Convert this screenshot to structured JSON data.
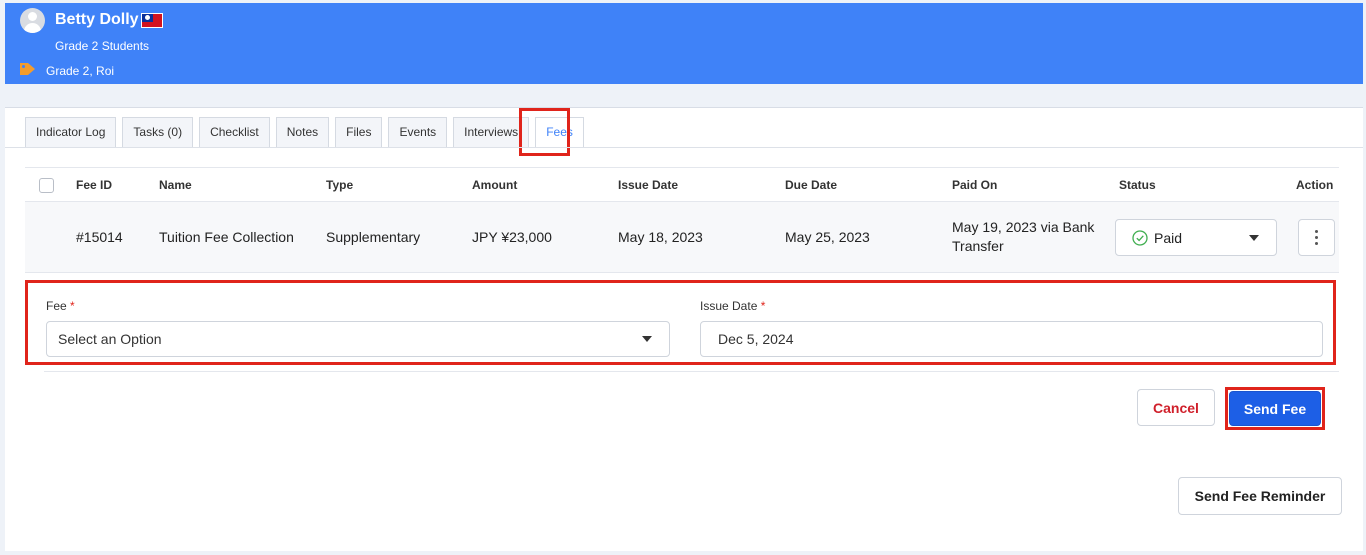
{
  "student": {
    "name": "Betty Dolly",
    "grade_line": "Grade 2 Students",
    "tags": "Grade 2, Roi"
  },
  "tabs": [
    {
      "label": "Indicator Log",
      "active": false
    },
    {
      "label": "Tasks (0)",
      "active": false
    },
    {
      "label": "Checklist",
      "active": false
    },
    {
      "label": "Notes",
      "active": false
    },
    {
      "label": "Files",
      "active": false
    },
    {
      "label": "Events",
      "active": false
    },
    {
      "label": "Interviews",
      "active": false
    },
    {
      "label": "Fees",
      "active": true
    }
  ],
  "table": {
    "headers": {
      "fee_id": "Fee ID",
      "name": "Name",
      "type": "Type",
      "amount": "Amount",
      "issue_date": "Issue Date",
      "due_date": "Due Date",
      "paid_on": "Paid On",
      "status": "Status",
      "action": "Action"
    },
    "rows": [
      {
        "fee_id": "#15014",
        "name": "Tuition Fee Collection",
        "type": "Supplementary",
        "amount": "JPY ¥23,000",
        "issue_date": "May 18, 2023",
        "due_date": "May 25, 2023",
        "paid_on": "May 19, 2023 via Bank Transfer",
        "status": "Paid"
      }
    ]
  },
  "form": {
    "fee_label": "Fee",
    "fee_placeholder": "Select an Option",
    "issue_date_label": "Issue Date",
    "issue_date_value": "Dec 5, 2024",
    "required_mark": "*"
  },
  "buttons": {
    "cancel": "Cancel",
    "send_fee": "Send Fee",
    "send_fee_reminder": "Send Fee Reminder"
  },
  "colors": {
    "header_bg": "#3f82f8",
    "primary": "#1d5fe6",
    "danger": "#d0202b",
    "highlight": "#e0241b",
    "success": "#3fae4f",
    "tag": "#f39c2c"
  },
  "icons": {
    "avatar": "avatar-icon",
    "flag": "taiwan-flag-icon",
    "tag": "tag-icon",
    "status": "check-circle-icon",
    "dropdown": "caret-down-icon",
    "action": "kebab-menu-icon"
  }
}
